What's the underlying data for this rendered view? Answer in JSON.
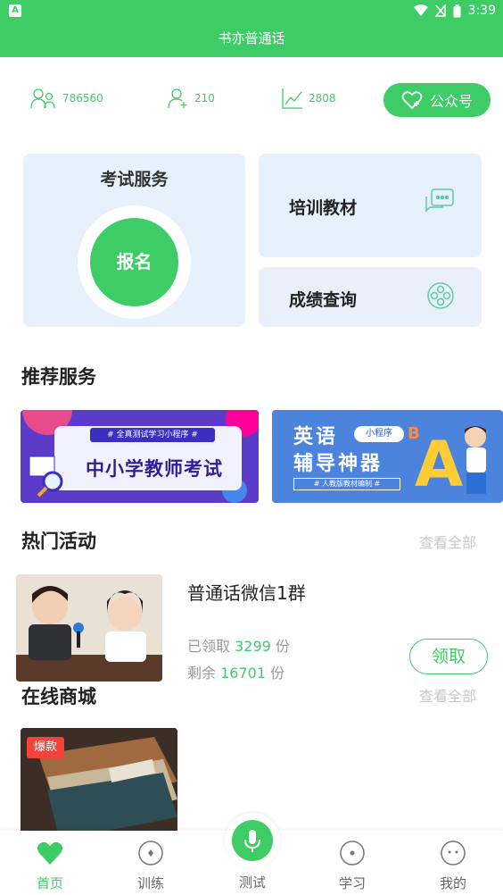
{
  "status": {
    "time": "3:39"
  },
  "app": {
    "title": "书亦普通话"
  },
  "stats": {
    "users": "786560",
    "new_users": "210",
    "trend": "2808",
    "gzh_label": "公众号"
  },
  "exam": {
    "title": "考试服务",
    "button": "报名"
  },
  "cards": {
    "materials": "培训教材",
    "scores": "成绩查询"
  },
  "recommend": {
    "title": "推荐服务",
    "banner1_tag": "# 全真测试学习小程序 #",
    "banner1_main": "中小学教师考试",
    "banner2_line1": "英语",
    "banner2_line2": "辅导神器",
    "banner2_pill": "小程序",
    "banner2_sub": "# 人教版教材编制 #",
    "banner2_letter": "A"
  },
  "activity": {
    "title": "热门活动",
    "see_all": "查看全部",
    "item_title": "普通话微信1群",
    "claimed_label": "已领取",
    "claimed_num": "3299",
    "remain_label": "剩余",
    "remain_num": "16701",
    "unit": "份",
    "claim_button": "领取"
  },
  "mall": {
    "title": "在线商城",
    "see_all": "查看全部",
    "hot_tag": "爆款"
  },
  "tabs": {
    "home": "首页",
    "train": "训练",
    "test": "测试",
    "study": "学习",
    "mine": "我的"
  },
  "colors": {
    "primary": "#3ecc66",
    "card_blue": "#e6f1fb",
    "hot": "#f5433b"
  }
}
